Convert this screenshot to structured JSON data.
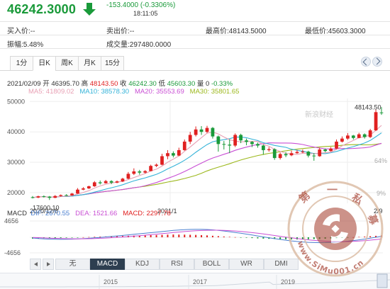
{
  "header": {
    "price": "46242.3000",
    "change": "-153.4000 (-0.3306%)",
    "time": "18:11:05"
  },
  "quote": {
    "buy": "买入价:--",
    "sell": "卖出价:--",
    "high": "最高价:48143.5000",
    "low": "最低价:45603.3000",
    "amplitude": "振幅:5.48%",
    "volume": "成交量:297480.0000"
  },
  "tabs": [
    "1分",
    "日K",
    "周K",
    "月K",
    "15分"
  ],
  "active_tab": "日K",
  "info_line": {
    "date": "2021/02/09",
    "open_label": "开",
    "open": "46395.70",
    "high_label": "高",
    "high": "48143.50",
    "close_label": "收",
    "close": "46242.30",
    "low_label": "低",
    "low": "45603.30",
    "vol_label": "量",
    "vol": "0",
    "pct": "-0.33%"
  },
  "ma_line": {
    "ma5": "MA5: 41809.02",
    "ma10": "MA10: 38578.30",
    "ma20": "MA20: 35553.69",
    "ma30": "MA30: 35801.65"
  },
  "macd_line": {
    "label": "MACD",
    "dif": "DIF: 2670.55",
    "dea": "DEA: 1521.66",
    "macd": "MACD: 2297.78"
  },
  "indicator_tabs": [
    "无",
    "MACD",
    "KDJ",
    "RSI",
    "BOLL",
    "WR",
    "DMI"
  ],
  "active_indicator": "MACD",
  "watermark": "新浪财经",
  "seal_text": "第一私募 www.SiMu001.cn",
  "colors": {
    "up": "#e02020",
    "down": "#1a9a3a",
    "ma5": "#e8a0b4",
    "ma10": "#35b3d8",
    "ma20": "#c94fd4",
    "ma30": "#9cb81c",
    "dif": "#4a7fd0",
    "dea": "#c94fd4",
    "macd": "#e02020"
  },
  "chart_data": {
    "type": "candlestick",
    "y_ticks": [
      "50000",
      "40000",
      "30000",
      "20000"
    ],
    "ylim": [
      16500,
      51000
    ],
    "x_labels": [
      "2020/12/8",
      "2021/1",
      "2/9"
    ],
    "annotations": {
      "max": "48143.50",
      "min": "17600.10"
    },
    "right_pct": [
      "64%",
      "9%"
    ],
    "macd_ticks": [
      "4656",
      "0",
      "-4656"
    ],
    "overview_years": [
      "2015",
      "2017",
      "2019"
    ],
    "candles": [
      [
        18500,
        18400,
        18900,
        18100
      ],
      [
        18400,
        18800,
        19000,
        18200
      ],
      [
        18800,
        18700,
        19100,
        18400
      ],
      [
        18700,
        18300,
        18900,
        17600
      ],
      [
        18300,
        18900,
        19200,
        18200
      ],
      [
        18900,
        19200,
        19400,
        18700
      ],
      [
        19200,
        19100,
        19500,
        18900
      ],
      [
        19100,
        19700,
        19900,
        19000
      ],
      [
        19700,
        21000,
        21500,
        19600
      ],
      [
        21000,
        21400,
        21800,
        20800
      ],
      [
        21400,
        22100,
        22300,
        21200
      ],
      [
        22100,
        23400,
        23800,
        21900
      ],
      [
        23400,
        23100,
        24000,
        22700
      ],
      [
        23100,
        23800,
        24200,
        23000
      ],
      [
        23800,
        23300,
        24100,
        22800
      ],
      [
        23300,
        23700,
        24000,
        23100
      ],
      [
        23700,
        24600,
        24900,
        23500
      ],
      [
        24600,
        26200,
        26800,
        24400
      ],
      [
        26200,
        27000,
        28000,
        25800
      ],
      [
        27000,
        26600,
        27500,
        25900
      ],
      [
        26600,
        27100,
        27400,
        26300
      ],
      [
        27100,
        28800,
        29200,
        27000
      ],
      [
        28800,
        29200,
        29600,
        28400
      ],
      [
        29200,
        32000,
        32800,
        29000
      ],
      [
        32000,
        33000,
        34000,
        31000
      ],
      [
        33000,
        32200,
        33600,
        31600
      ],
      [
        32200,
        34000,
        34800,
        32000
      ],
      [
        34000,
        36800,
        37500,
        33800
      ],
      [
        36800,
        39000,
        40000,
        36000
      ],
      [
        39000,
        40800,
        41800,
        38500
      ],
      [
        40800,
        40000,
        41900,
        39000
      ],
      [
        40000,
        41300,
        42000,
        39600
      ],
      [
        41300,
        38500,
        41600,
        37800
      ],
      [
        38500,
        36000,
        38800,
        33500
      ],
      [
        36000,
        35800,
        37000,
        34200
      ],
      [
        35800,
        35500,
        37500,
        33000
      ],
      [
        35500,
        39000,
        39500,
        35000
      ],
      [
        39000,
        37200,
        39400,
        36300
      ],
      [
        37200,
        36700,
        37800,
        35600
      ],
      [
        36700,
        36000,
        37000,
        35000
      ],
      [
        36000,
        35500,
        36500,
        34800
      ],
      [
        35500,
        34000,
        35800,
        32500
      ],
      [
        34000,
        34300,
        35000,
        33500
      ],
      [
        34300,
        31400,
        34600,
        30800
      ],
      [
        31400,
        32700,
        33200,
        30900
      ],
      [
        32700,
        32300,
        33300,
        31700
      ],
      [
        32300,
        33000,
        33800,
        32000
      ],
      [
        33000,
        33400,
        34000,
        32800
      ],
      [
        33400,
        33500,
        34200,
        33000
      ],
      [
        33500,
        32200,
        33800,
        31600
      ],
      [
        32200,
        32000,
        33000,
        30500
      ],
      [
        32000,
        34200,
        34800,
        31800
      ],
      [
        34200,
        33700,
        34500,
        33300
      ],
      [
        33700,
        34500,
        35000,
        33500
      ],
      [
        34500,
        36800,
        37500,
        34300
      ],
      [
        36800,
        37800,
        38500,
        36500
      ],
      [
        37800,
        38800,
        39600,
        37400
      ],
      [
        38800,
        38000,
        39000,
        37500
      ],
      [
        38000,
        39200,
        39700,
        37900
      ],
      [
        39200,
        38300,
        39500,
        37800
      ],
      [
        38300,
        40500,
        41000,
        38000
      ],
      [
        40500,
        46500,
        47300,
        40300
      ],
      [
        46395.7,
        46242.3,
        48143.5,
        45603.3
      ]
    ],
    "macd_values": [
      -380,
      -330,
      -300,
      -260,
      -220,
      -180,
      -140,
      -90,
      -40,
      20,
      80,
      140,
      200,
      240,
      280,
      330,
      380,
      440,
      500,
      540,
      570,
      610,
      650,
      700,
      760,
      800,
      780,
      760,
      720,
      680,
      620,
      540,
      440,
      330,
      220,
      130,
      40,
      -50,
      -130,
      -220,
      -310,
      -380,
      -440,
      -490,
      -540,
      -570,
      -600,
      -610,
      -590,
      -560,
      -520,
      -470,
      -400,
      -320,
      -240,
      -160,
      -70,
      20,
      110,
      200,
      300,
      420,
      560
    ],
    "series": [
      {
        "name": "MA5",
        "values": "computed"
      },
      {
        "name": "MA10",
        "values": "computed"
      },
      {
        "name": "MA20",
        "values": "computed"
      },
      {
        "name": "MA30",
        "values": "computed"
      }
    ]
  }
}
